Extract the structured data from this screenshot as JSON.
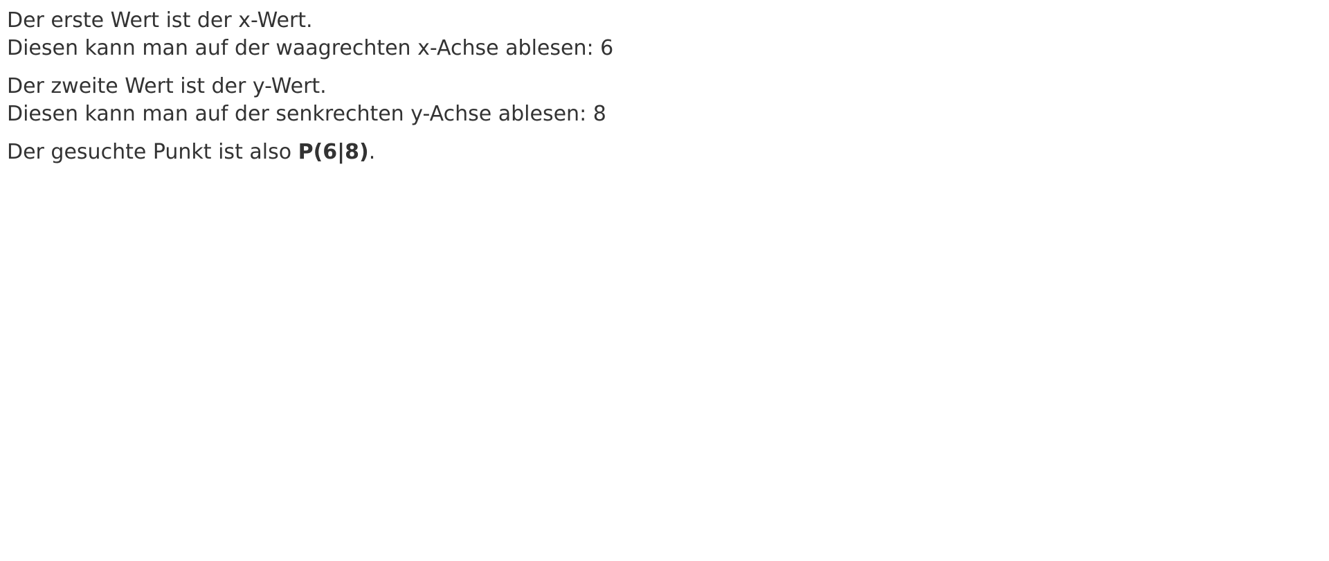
{
  "paragraphs": {
    "x_value": {
      "line1": "Der erste Wert ist der x-Wert.",
      "line2": "Diesen kann man auf der waagrechten x-Achse ablesen: 6"
    },
    "y_value": {
      "line1": "Der zweite Wert ist der y-Wert.",
      "line2": "Diesen kann man auf der senkrechten y-Achse ablesen: 8"
    },
    "result": {
      "prefix": "Der gesuchte Punkt ist also ",
      "point": "P(6|8)",
      "suffix": "."
    }
  },
  "colors": {
    "text": "#333333",
    "background": "#ffffff"
  }
}
